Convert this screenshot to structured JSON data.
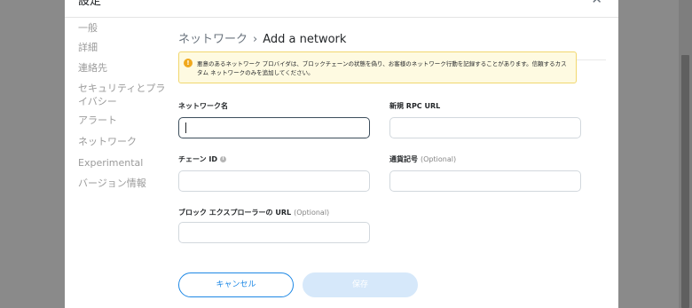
{
  "header": {
    "title": "設定",
    "close": "✕"
  },
  "sidebar": {
    "items": [
      {
        "label": "一般"
      },
      {
        "label": "詳細"
      },
      {
        "label": "連絡先"
      },
      {
        "label": "セキュリティとプライバシー"
      },
      {
        "label": "アラート"
      },
      {
        "label": "ネットワーク"
      },
      {
        "label": "Experimental"
      },
      {
        "label": "バージョン情報"
      }
    ]
  },
  "breadcrumb": {
    "parent": "ネットワーク",
    "separator": "›",
    "current": "Add a network"
  },
  "warning": {
    "icon": "!",
    "text": "悪意のあるネットワーク プロバイダは、ブロックチェーンの状態を偽り、お客様のネットワーク行動を記録することがあります。信頼するカスタム ネットワークのみを追加してください。"
  },
  "form": {
    "network_name": {
      "label": "ネットワーク名",
      "value": ""
    },
    "rpc_url": {
      "label": "新規 RPC URL",
      "value": ""
    },
    "chain_id": {
      "label": "チェーン ID",
      "info": "i",
      "value": ""
    },
    "symbol": {
      "label": "通貨記号",
      "optional": "(Optional)",
      "value": ""
    },
    "explorer_url": {
      "label": "ブロック エクスプローラーの URL",
      "optional": "(Optional)",
      "value": ""
    }
  },
  "buttons": {
    "cancel": "キャンセル",
    "save": "保存"
  },
  "colors": {
    "accent": "#1e88e5",
    "warning_bg": "#fefae1",
    "warning_border": "#f1d76e",
    "save_disabled": "#d6e8fa"
  }
}
